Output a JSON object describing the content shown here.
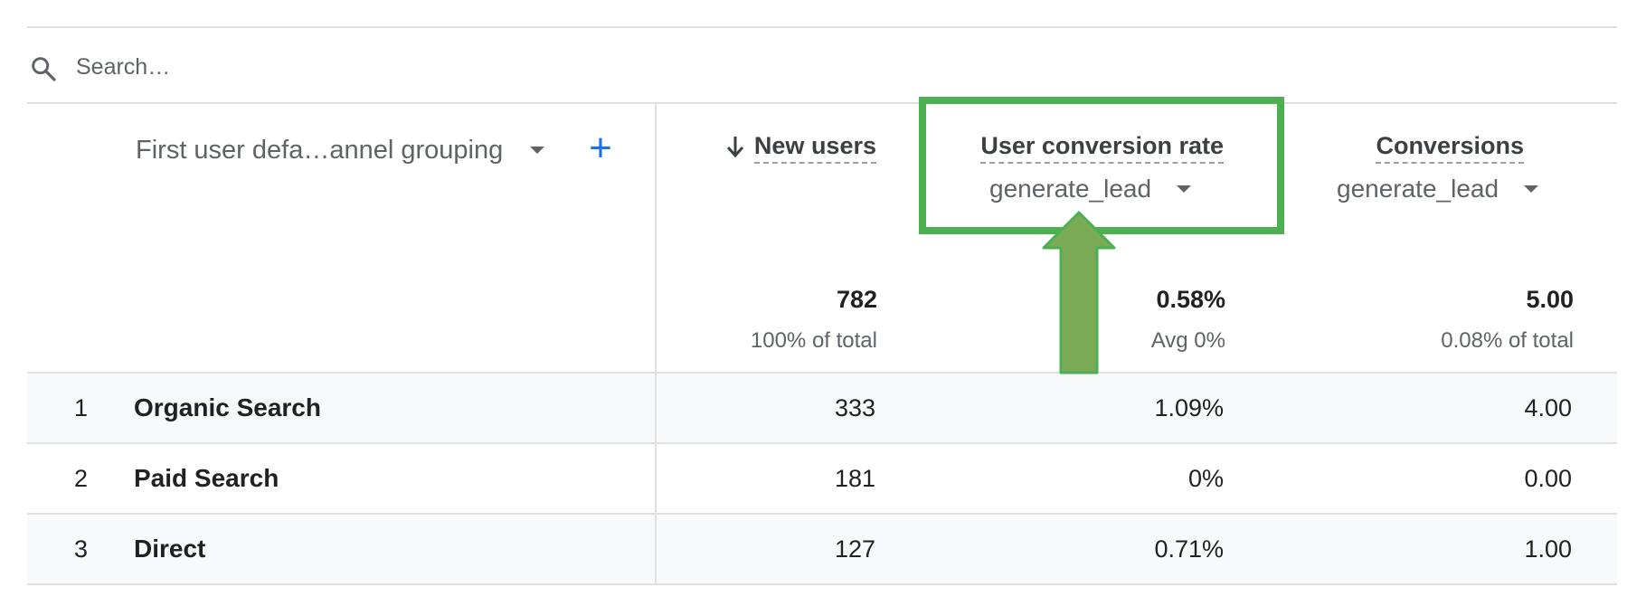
{
  "search": {
    "placeholder": "Search…"
  },
  "dimension": {
    "label": "First user defa…annel grouping",
    "add_icon": "+"
  },
  "columns": [
    {
      "name": "New users",
      "sorted": "descending",
      "event": null
    },
    {
      "name": "User conversion rate",
      "event": "generate_lead"
    },
    {
      "name": "Conversions",
      "event": "generate_lead"
    }
  ],
  "totals": [
    {
      "value": "782",
      "sub": "100% of total"
    },
    {
      "value": "0.58%",
      "sub": "Avg 0%"
    },
    {
      "value": "5.00",
      "sub": "0.08% of total"
    }
  ],
  "rows": [
    {
      "index": "1",
      "channel": "Organic Search",
      "new_users": "333",
      "conversion_rate": "1.09%",
      "conversions": "4.00"
    },
    {
      "index": "2",
      "channel": "Paid Search",
      "new_users": "181",
      "conversion_rate": "0%",
      "conversions": "0.00"
    },
    {
      "index": "3",
      "channel": "Direct",
      "new_users": "127",
      "conversion_rate": "0.71%",
      "conversions": "1.00"
    }
  ],
  "colors": {
    "accent_blue": "#1a73e8",
    "annotation_green": "#4caf50",
    "arrow_green": "#7cab57",
    "row_shade": "#f8f9fa",
    "divider": "#e0e0e0"
  },
  "icons": {
    "search": "search-icon",
    "sort": "arrow-down-icon",
    "dropdown": "caret-down-icon",
    "add": "plus-icon"
  }
}
